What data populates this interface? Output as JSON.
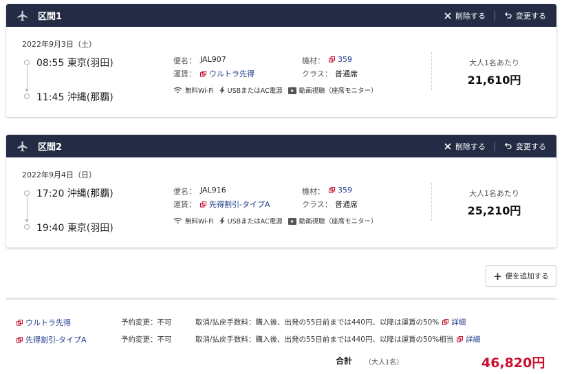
{
  "segments": [
    {
      "title": "区間1",
      "delete_label": "削除する",
      "change_label": "変更する",
      "date": "2022年9月3日（土）",
      "dep_time": "08:55",
      "dep_place": "東京(羽田)",
      "arr_time": "11:45",
      "arr_place": "沖縄(那覇)",
      "flight_label": "便名：",
      "flight": "JAL907",
      "fare_label": "運賃：",
      "fare": "ウルトラ先得",
      "aircraft_label": "機材：",
      "aircraft": "359",
      "class_label": "クラス：",
      "class": "普通席",
      "wifi": "無料Wi-Fi",
      "power": "USBまたはAC電源",
      "video": "動画視聴（座席モニター）",
      "price_note": "大人1名あたり",
      "price": "21,610円"
    },
    {
      "title": "区間2",
      "delete_label": "削除する",
      "change_label": "変更する",
      "date": "2022年9月4日（日）",
      "dep_time": "17:20",
      "dep_place": "沖縄(那覇)",
      "arr_time": "19:40",
      "arr_place": "東京(羽田)",
      "flight_label": "便名：",
      "flight": "JAL916",
      "fare_label": "運賃：",
      "fare": "先得割引-タイプA",
      "aircraft_label": "機材：",
      "aircraft": "359",
      "class_label": "クラス：",
      "class": "普通席",
      "wifi": "無料Wi-Fi",
      "power": "USBまたはAC電源",
      "video": "動画視聴（座席モニター）",
      "price_note": "大人1名あたり",
      "price": "25,210円"
    }
  ],
  "add_flight_label": "便を追加する",
  "fares": [
    {
      "name": "ウルトラ先得",
      "change": "予約変更：不可",
      "cancel": "取消/払戻手数料：購入後、出発の55日前までは440円、以降は運賃の50%",
      "detail": "詳細"
    },
    {
      "name": "先得割引-タイプA",
      "change": "予約変更：不可",
      "cancel": "取消/払戻手数料：購入後、出発の55日前までは440円、以降は運賃の50%相当",
      "detail": "詳細"
    }
  ],
  "total": {
    "label": "合計",
    "sub": "（大人1名）",
    "price": "46,820円"
  },
  "colors": {
    "header_bg": "#232c44",
    "link": "#1e3a8a",
    "external_icon": "#c8102e",
    "total_price": "#c8102e"
  }
}
